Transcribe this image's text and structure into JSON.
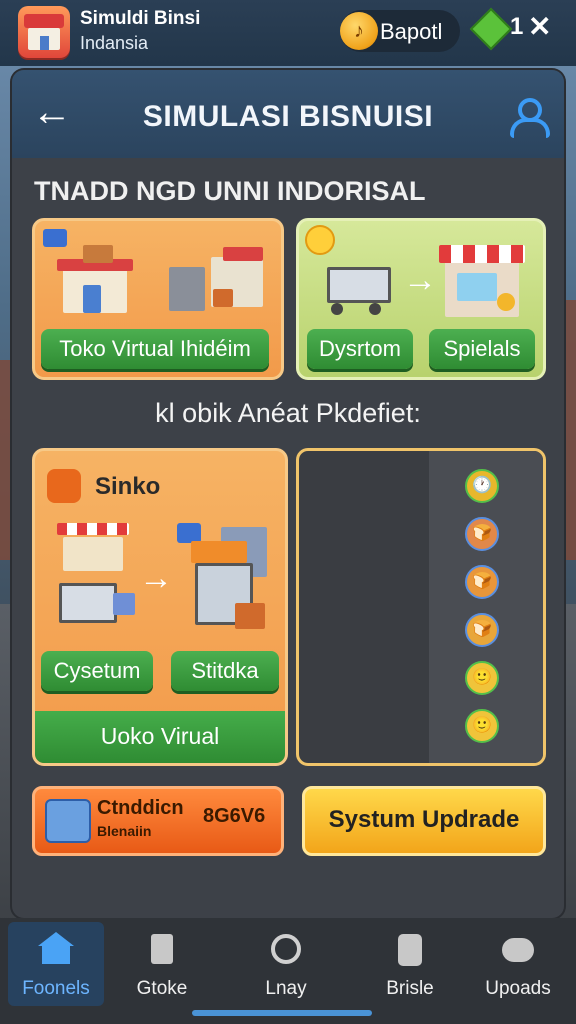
{
  "topbar": {
    "app_title": "Simuldi Binsi",
    "app_subtitle": "Indansia",
    "coin_label": "Bapotl",
    "gem_count": "1",
    "close_symbol": "✕"
  },
  "panel": {
    "back_symbol": "←",
    "title": "SIMULASI BISNUISI",
    "section_title": "TNADD NGD UNNI INDORISAL",
    "subtitle": "kl obik Anéat Pkdefiet:"
  },
  "cards": {
    "toko_virtual": {
      "button": "Toko Virtual Ihidéim"
    },
    "dysrtom": {
      "button_left": "Dysrtom",
      "button_right": "Spielals"
    },
    "sinko": {
      "title": "Sinko",
      "button_left": "Cysetum",
      "button_right": "Stitdka",
      "bottom_button": "Uoko Virual"
    },
    "icon_list": [
      "🕐",
      "🍞",
      "🍞",
      "🍞",
      "🙂",
      "🙂"
    ]
  },
  "banners": {
    "left_title": "Ctnddicn",
    "left_sub": "Blenaiin",
    "left_value": "8G6V6",
    "right": "Systum Updrade"
  },
  "bottom_nav": [
    {
      "label": "Foonels",
      "icon": "home-icon"
    },
    {
      "label": "Gtoke",
      "icon": "trash-icon"
    },
    {
      "label": "Lnay",
      "icon": "search-icon"
    },
    {
      "label": "Brisle",
      "icon": "phone-icon"
    },
    {
      "label": "Upoads",
      "icon": "gamepad-icon"
    }
  ],
  "colors": {
    "accent_blue": "#3b9bf5",
    "button_green": "#3a9e3f",
    "banner_orange": "#f06a1f",
    "banner_yellow": "#f7c22d"
  }
}
